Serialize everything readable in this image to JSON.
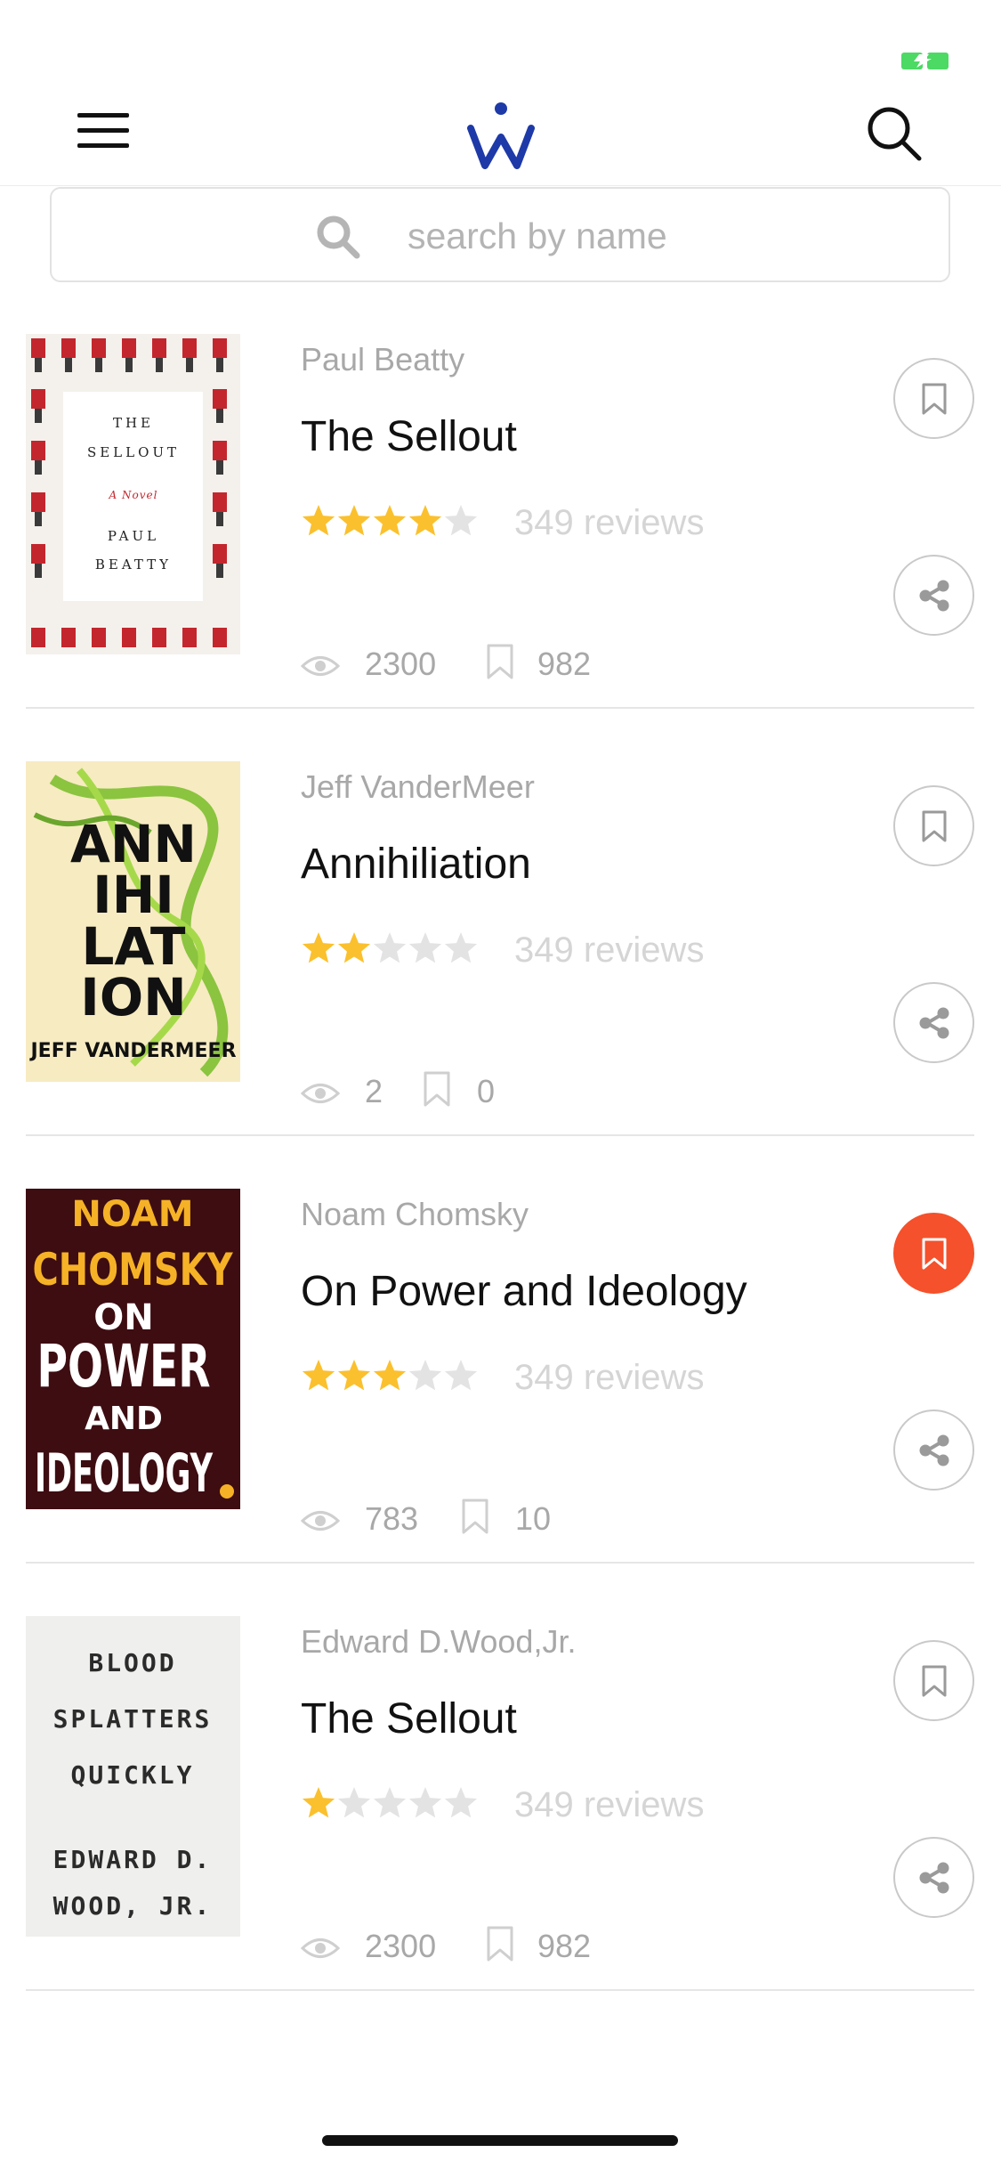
{
  "colors": {
    "brand": "#1e3aa8",
    "accent": "#f4512c",
    "star": "#fbc02d",
    "star_empty": "#e3e3e3",
    "battery": "#4cd964"
  },
  "header": {
    "menu_icon": "menu-icon",
    "logo_icon": "logo-w-icon",
    "search_icon": "search-icon"
  },
  "search": {
    "placeholder": "search by name",
    "icon": "search-icon"
  },
  "books": [
    {
      "author": "Paul Beatty",
      "title": "The Sellout",
      "rating": 4,
      "max_rating": 5,
      "reviews": "349 reviews",
      "views": "2300",
      "saved": "982",
      "bookmarked": false
    },
    {
      "author": "Jeff VanderMeer",
      "title": "Annihiliation",
      "rating": 2,
      "max_rating": 5,
      "reviews": "349 reviews",
      "views": "2",
      "saved": "0",
      "bookmarked": false
    },
    {
      "author": "Noam Chomsky",
      "title": "On Power and Ideology",
      "rating": 3,
      "max_rating": 5,
      "reviews": "349 reviews",
      "views": "783",
      "saved": "10",
      "bookmarked": true
    },
    {
      "author": "Edward D.Wood,Jr.",
      "title": "The Sellout",
      "rating": 1,
      "max_rating": 5,
      "reviews": "349 reviews",
      "views": "2300",
      "saved": "982",
      "bookmarked": false
    }
  ],
  "covers": [
    {
      "lines": [
        "THE",
        "SELLOUT",
        "A Novel",
        "PAUL",
        "BEATTY"
      ]
    },
    {
      "lines": [
        "ANN",
        "IHI",
        "LAT",
        "ION",
        "JEFF VANDERMEER"
      ]
    },
    {
      "lines": [
        "NOAM",
        "CHOMSKY",
        "ON",
        "POWER",
        "AND",
        "IDEOLOGY"
      ]
    },
    {
      "lines": [
        "BLOOD",
        "SPLATTERS",
        "QUICKLY",
        "EDWARD D.",
        "WOOD, JR."
      ]
    }
  ]
}
